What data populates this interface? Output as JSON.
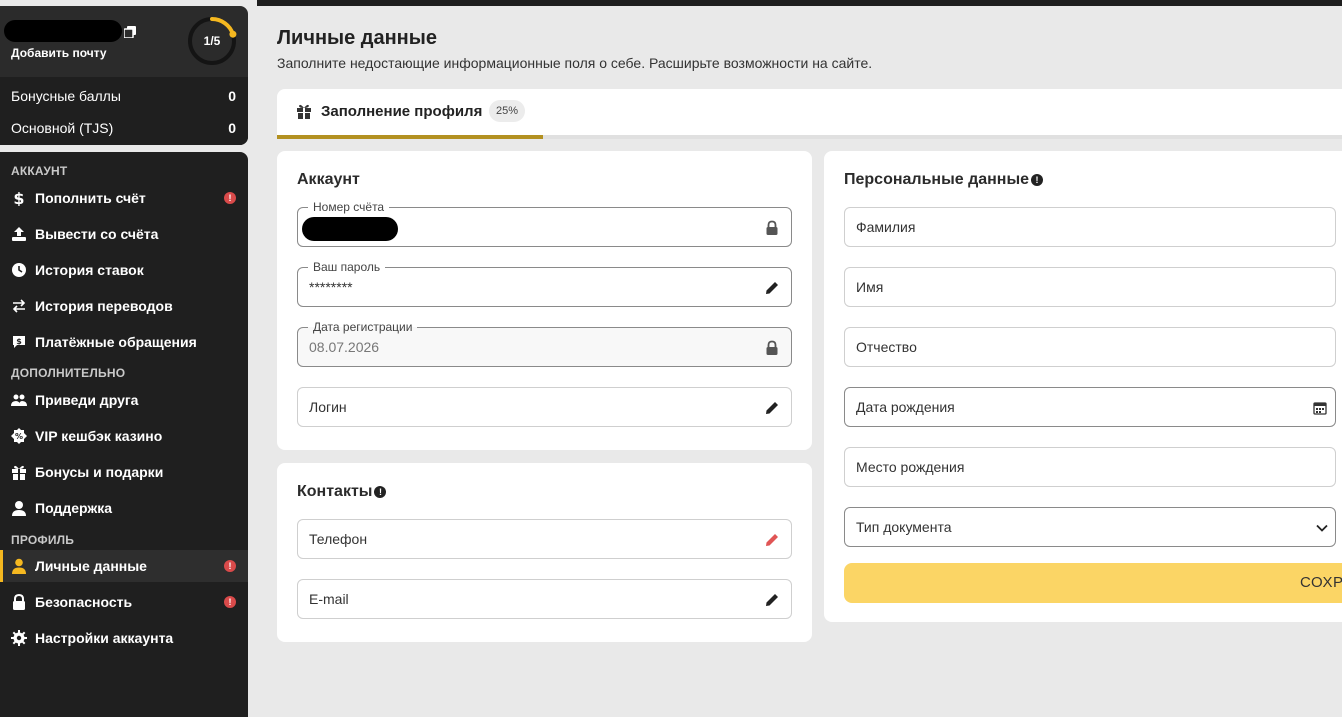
{
  "profile": {
    "add_email": "Добавить почту",
    "progress_steps": "1/5",
    "progress_fraction": 0.2,
    "balances": [
      {
        "label": "Бонусные баллы",
        "value": "0"
      },
      {
        "label": "Основной (TJS)",
        "value": "0"
      }
    ]
  },
  "sidebar": {
    "sections": {
      "account": "АККАУНТ",
      "extra": "ДОПОЛНИТЕЛЬНО",
      "profile": "ПРОФИЛЬ"
    },
    "items": [
      {
        "label": "Пополнить счёт",
        "icon": "dollar-icon",
        "alert": true
      },
      {
        "label": "Вывести со счёта",
        "icon": "upload-icon",
        "alert": false
      },
      {
        "label": "История ставок",
        "icon": "clock-icon",
        "alert": false
      },
      {
        "label": "История переводов",
        "icon": "transfer-icon",
        "alert": false
      },
      {
        "label": "Платёжные обращения",
        "icon": "payment-ticket-icon",
        "alert": false
      },
      {
        "label": "Приведи друга",
        "icon": "users-icon",
        "alert": false
      },
      {
        "label": "VIP кешбэк казино",
        "icon": "percent-badge-icon",
        "alert": false
      },
      {
        "label": "Бонусы и подарки",
        "icon": "gift-icon",
        "alert": false
      },
      {
        "label": "Поддержка",
        "icon": "support-agent-icon",
        "alert": false
      },
      {
        "label": "Личные данные",
        "icon": "user-icon",
        "alert": true
      },
      {
        "label": "Безопасность",
        "icon": "lock-icon",
        "alert": true
      },
      {
        "label": "Настройки аккаунта",
        "icon": "gear-icon",
        "alert": false
      }
    ],
    "alert_symbol": "!"
  },
  "main": {
    "title": "Личные данные",
    "subtitle": "Заполните недостающие информационные поля о себе. Расширьте возможности на сайте.",
    "progress": {
      "label": "Заполнение профиля",
      "badge": "25%",
      "fraction": 0.25
    }
  },
  "account_card": {
    "title": "Аккаунт",
    "fields": {
      "account_number": {
        "legend": "Номер счёта"
      },
      "password": {
        "legend": "Ваш пароль",
        "value": "********"
      },
      "reg_date": {
        "legend": "Дата регистрации",
        "value": "08.07.2026"
      },
      "login": {
        "placeholder": "Логин"
      }
    }
  },
  "contacts_card": {
    "title": "Контакты",
    "phone": "Телефон",
    "email": "E-mail"
  },
  "personal_card": {
    "title": "Персональные данные",
    "last_name": "Фамилия",
    "first_name": "Имя",
    "patronymic": "Отчество",
    "birth_date": "Дата рождения",
    "birth_place": "Место рождения",
    "doc_type": "Тип документа",
    "save": "СОХР"
  },
  "colors": {
    "accent": "#f5b820",
    "progress": "#b39121",
    "save_button": "#fbd565",
    "alert": "#d94a4a",
    "sidebar_bg": "#1f1f1f"
  }
}
